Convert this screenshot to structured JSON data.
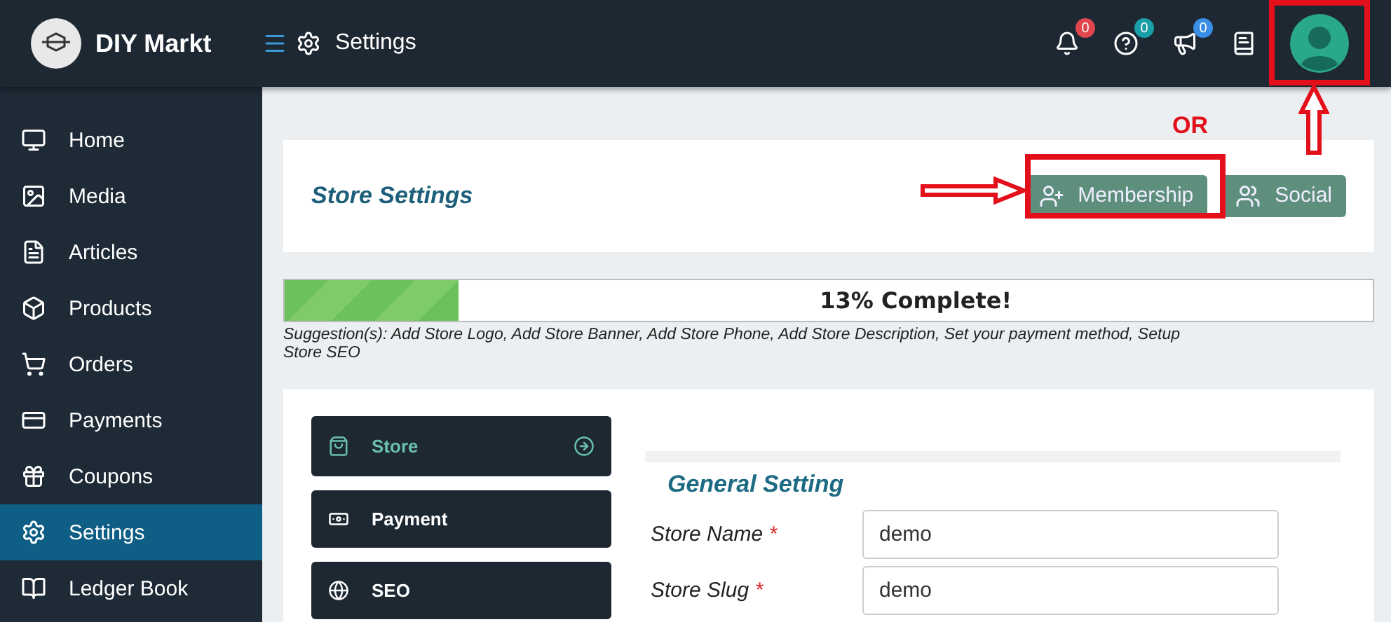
{
  "header": {
    "brand": "DIY Markt",
    "page_title": "Settings",
    "badges": [
      {
        "count": "0",
        "color": "#e0464e"
      },
      {
        "count": "0",
        "color": "#1a9fa8"
      },
      {
        "count": "0",
        "color": "#3a8ee6"
      }
    ]
  },
  "sidebar": {
    "items": [
      {
        "label": "Home",
        "selected": false
      },
      {
        "label": "Media",
        "selected": false
      },
      {
        "label": "Articles",
        "selected": false
      },
      {
        "label": "Products",
        "selected": false
      },
      {
        "label": "Orders",
        "selected": false
      },
      {
        "label": "Payments",
        "selected": false
      },
      {
        "label": "Coupons",
        "selected": false
      },
      {
        "label": "Settings",
        "selected": true
      },
      {
        "label": "Ledger Book",
        "selected": false
      }
    ]
  },
  "store_card": {
    "title": "Store Settings",
    "buttons": [
      "Membership",
      "Social"
    ]
  },
  "progress": {
    "level": 0.16,
    "label": "13% Complete!",
    "suggestion": "Suggestion(s): Add Store Logo, Add Store Banner, Add Store Phone, Add Store Description, Set your payment method, Setup Store SEO"
  },
  "tabs": [
    {
      "label": "Store",
      "selected": true
    },
    {
      "label": "Payment",
      "selected": false
    },
    {
      "label": "SEO",
      "selected": false
    }
  ],
  "form": {
    "title": "General Setting",
    "required_mark": "*",
    "fields": [
      {
        "label": "Store Name",
        "required": true,
        "value": "demo"
      },
      {
        "label": "Store Slug",
        "required": true,
        "value": "demo"
      }
    ]
  },
  "annotation": {
    "text": "OR"
  }
}
